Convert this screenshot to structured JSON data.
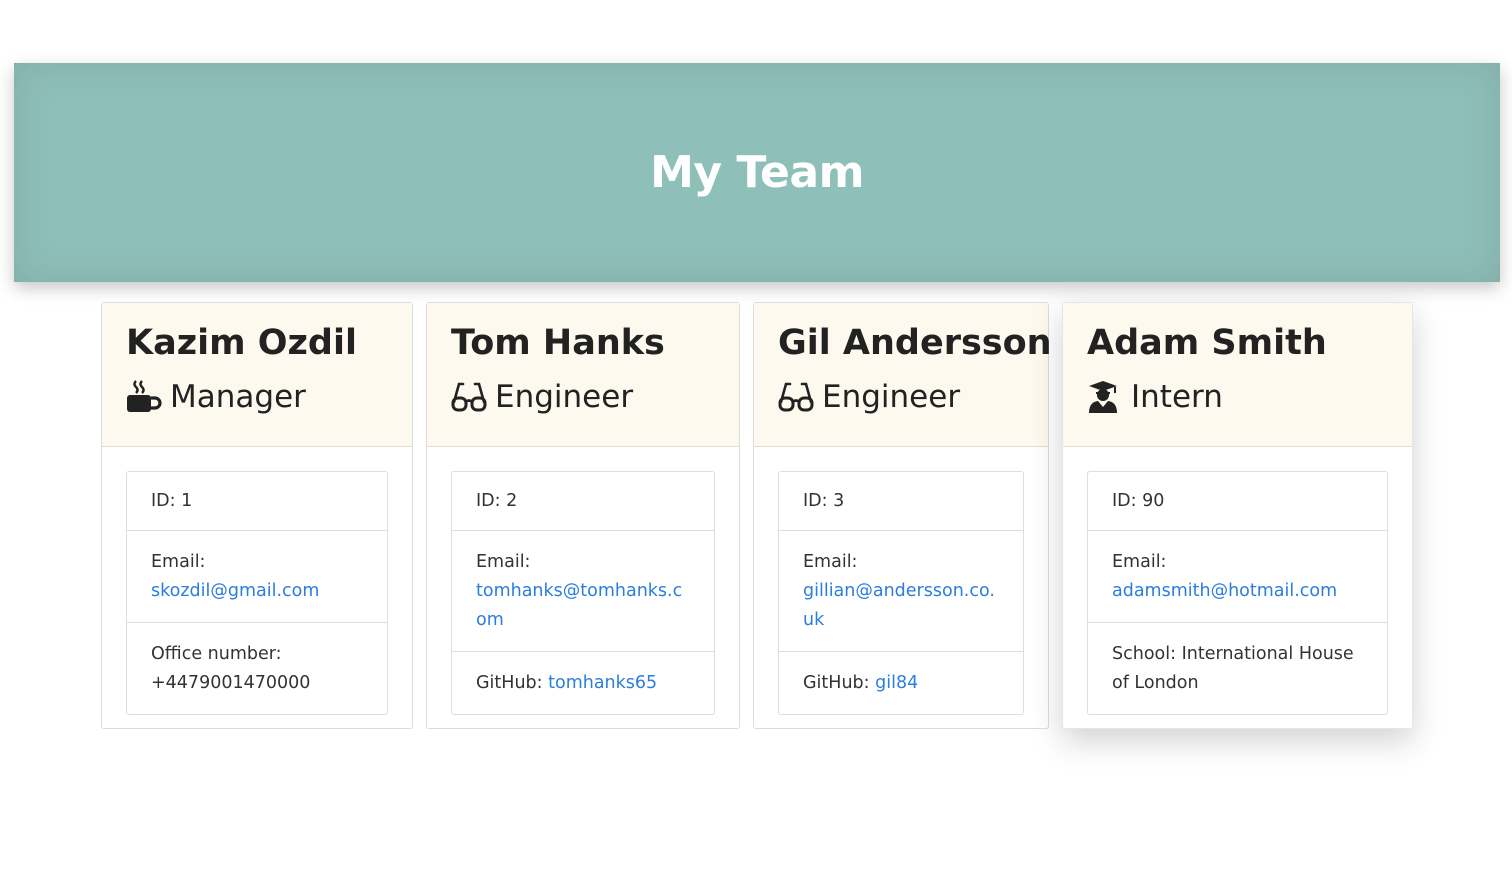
{
  "header": {
    "title": "My Team"
  },
  "colors": {
    "banner": "#8fbfb9",
    "card_header": "#fdf9ef",
    "link": "#2b7de0"
  },
  "team": [
    {
      "name": "Kazim Ozdil",
      "role": "Manager",
      "role_icon": "mug-icon",
      "id_text": "ID: 1",
      "email_label": "Email:",
      "email": "skozdil@gmail.com",
      "extra_label": "Office number:",
      "extra_value": "+4479001470000"
    },
    {
      "name": "Tom Hanks",
      "role": "Engineer",
      "role_icon": "glasses-icon",
      "id_text": "ID: 2",
      "email_label": "Email:",
      "email": "tomhanks@tomhanks.com",
      "extra_label": "GitHub:",
      "extra_value": "tomhanks65"
    },
    {
      "name": "Gil Andersson",
      "role": "Engineer",
      "role_icon": "glasses-icon",
      "id_text": "ID: 3",
      "email_label": "Email:",
      "email": "gillian@andersson.co.uk",
      "extra_label": "GitHub:",
      "extra_value": "gil84"
    },
    {
      "name": "Adam Smith",
      "role": "Intern",
      "role_icon": "graduate-icon",
      "id_text": "ID: 90",
      "email_label": "Email:",
      "email": "adamsmith@hotmail.com",
      "extra_label": "School:",
      "extra_value": "International House of London"
    }
  ]
}
